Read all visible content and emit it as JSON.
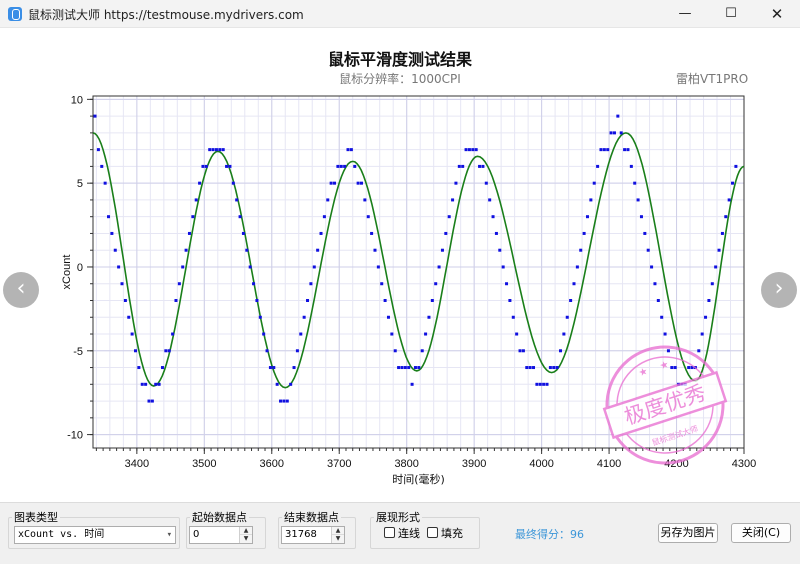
{
  "window": {
    "title": "鼠标测试大师 https://testmouse.mydrivers.com",
    "minimize_glyph": "—",
    "maximize_glyph": "☐",
    "close_glyph": "✕"
  },
  "nav": {
    "prev_glyph": "‹",
    "next_glyph": "›"
  },
  "header": {
    "title": "鼠标平滑度测试结果",
    "subtitle": "鼠标分辨率：1000CPI",
    "device": "雷柏VT1PRO"
  },
  "stamp": {
    "text": "极度优秀",
    "inner_text": "鼠标测试大师",
    "color": "#e86ad0"
  },
  "chart_data": {
    "type": "scatter",
    "xlabel": "时间(毫秒)",
    "ylabel": "xCount",
    "xlim": [
      3335,
      3303.5
    ],
    "x_range": [
      3335,
      3300
    ],
    "ylim": [
      -10.8,
      10.2
    ],
    "x_ticks": [
      3400,
      3500,
      3600,
      3700,
      3800,
      3900,
      4000,
      4100,
      4200,
      4300
    ],
    "y_ticks": [
      10,
      5,
      0,
      -5,
      -10
    ],
    "grid": true,
    "series": [
      {
        "kind": "points",
        "color": "#1010e0",
        "points": [
          [
            3338,
            9
          ],
          [
            3343,
            7
          ],
          [
            3348,
            6
          ],
          [
            3353,
            5
          ],
          [
            3358,
            3
          ],
          [
            3363,
            2
          ],
          [
            3368,
            1
          ],
          [
            3373,
            0
          ],
          [
            3378,
            -1
          ],
          [
            3383,
            -2
          ],
          [
            3388,
            -3
          ],
          [
            3393,
            -4
          ],
          [
            3398,
            -5
          ],
          [
            3403,
            -6
          ],
          [
            3408,
            -7
          ],
          [
            3413,
            -7
          ],
          [
            3418,
            -8
          ],
          [
            3423,
            -8
          ],
          [
            3428,
            -7
          ],
          [
            3433,
            -7
          ],
          [
            3438,
            -6
          ],
          [
            3443,
            -5
          ],
          [
            3448,
            -5
          ],
          [
            3453,
            -4
          ],
          [
            3458,
            -2
          ],
          [
            3463,
            -1
          ],
          [
            3468,
            0
          ],
          [
            3473,
            1
          ],
          [
            3478,
            2
          ],
          [
            3483,
            3
          ],
          [
            3488,
            4
          ],
          [
            3493,
            5
          ],
          [
            3498,
            6
          ],
          [
            3503,
            6
          ],
          [
            3508,
            7
          ],
          [
            3513,
            7
          ],
          [
            3518,
            7
          ],
          [
            3523,
            7
          ],
          [
            3528,
            7
          ],
          [
            3533,
            6
          ],
          [
            3538,
            6
          ],
          [
            3543,
            5
          ],
          [
            3548,
            4
          ],
          [
            3553,
            3
          ],
          [
            3558,
            2
          ],
          [
            3563,
            1
          ],
          [
            3568,
            0
          ],
          [
            3573,
            -1
          ],
          [
            3578,
            -2
          ],
          [
            3583,
            -3
          ],
          [
            3588,
            -4
          ],
          [
            3593,
            -5
          ],
          [
            3598,
            -6
          ],
          [
            3603,
            -6
          ],
          [
            3608,
            -7
          ],
          [
            3613,
            -8
          ],
          [
            3618,
            -8
          ],
          [
            3623,
            -8
          ],
          [
            3628,
            -7
          ],
          [
            3633,
            -6
          ],
          [
            3638,
            -5
          ],
          [
            3643,
            -4
          ],
          [
            3648,
            -3
          ],
          [
            3653,
            -2
          ],
          [
            3658,
            -1
          ],
          [
            3663,
            0
          ],
          [
            3668,
            1
          ],
          [
            3673,
            2
          ],
          [
            3678,
            3
          ],
          [
            3683,
            4
          ],
          [
            3688,
            5
          ],
          [
            3693,
            5
          ],
          [
            3698,
            6
          ],
          [
            3703,
            6
          ],
          [
            3708,
            6
          ],
          [
            3713,
            7
          ],
          [
            3718,
            7
          ],
          [
            3723,
            6
          ],
          [
            3728,
            5
          ],
          [
            3733,
            5
          ],
          [
            3738,
            4
          ],
          [
            3743,
            3
          ],
          [
            3748,
            2
          ],
          [
            3753,
            1
          ],
          [
            3758,
            0
          ],
          [
            3763,
            -1
          ],
          [
            3768,
            -2
          ],
          [
            3773,
            -3
          ],
          [
            3778,
            -4
          ],
          [
            3783,
            -5
          ],
          [
            3788,
            -6
          ],
          [
            3793,
            -6
          ],
          [
            3798,
            -6
          ],
          [
            3803,
            -6
          ],
          [
            3808,
            -7
          ],
          [
            3813,
            -6
          ],
          [
            3818,
            -6
          ],
          [
            3823,
            -5
          ],
          [
            3828,
            -4
          ],
          [
            3833,
            -3
          ],
          [
            3838,
            -2
          ],
          [
            3843,
            -1
          ],
          [
            3848,
            0
          ],
          [
            3853,
            1
          ],
          [
            3858,
            2
          ],
          [
            3863,
            3
          ],
          [
            3868,
            4
          ],
          [
            3873,
            5
          ],
          [
            3878,
            6
          ],
          [
            3883,
            6
          ],
          [
            3888,
            7
          ],
          [
            3893,
            7
          ],
          [
            3898,
            7
          ],
          [
            3903,
            7
          ],
          [
            3908,
            6
          ],
          [
            3913,
            6
          ],
          [
            3918,
            5
          ],
          [
            3923,
            4
          ],
          [
            3928,
            3
          ],
          [
            3933,
            2
          ],
          [
            3938,
            1
          ],
          [
            3943,
            0
          ],
          [
            3948,
            -1
          ],
          [
            3953,
            -2
          ],
          [
            3958,
            -3
          ],
          [
            3963,
            -4
          ],
          [
            3968,
            -5
          ],
          [
            3973,
            -5
          ],
          [
            3978,
            -6
          ],
          [
            3983,
            -6
          ],
          [
            3988,
            -6
          ],
          [
            3993,
            -7
          ],
          [
            3998,
            -7
          ],
          [
            4003,
            -7
          ],
          [
            4008,
            -7
          ],
          [
            4013,
            -6
          ],
          [
            4018,
            -6
          ],
          [
            4023,
            -6
          ],
          [
            4028,
            -5
          ],
          [
            4033,
            -4
          ],
          [
            4038,
            -3
          ],
          [
            4043,
            -2
          ],
          [
            4048,
            -1
          ],
          [
            4053,
            0
          ],
          [
            4058,
            1
          ],
          [
            4063,
            2
          ],
          [
            4068,
            3
          ],
          [
            4073,
            4
          ],
          [
            4078,
            5
          ],
          [
            4083,
            6
          ],
          [
            4088,
            7
          ],
          [
            4093,
            7
          ],
          [
            4098,
            7
          ],
          [
            4103,
            8
          ],
          [
            4108,
            8
          ],
          [
            4113,
            9
          ],
          [
            4118,
            8
          ],
          [
            4123,
            7
          ],
          [
            4128,
            7
          ],
          [
            4133,
            6
          ],
          [
            4138,
            5
          ],
          [
            4143,
            4
          ],
          [
            4148,
            3
          ],
          [
            4153,
            2
          ],
          [
            4158,
            1
          ],
          [
            4163,
            0
          ],
          [
            4168,
            -1
          ],
          [
            4173,
            -2
          ],
          [
            4178,
            -3
          ],
          [
            4183,
            -4
          ],
          [
            4188,
            -5
          ],
          [
            4193,
            -6
          ],
          [
            4198,
            -6
          ],
          [
            4203,
            -7
          ],
          [
            4208,
            -7
          ],
          [
            4213,
            -7
          ],
          [
            4218,
            -6
          ],
          [
            4223,
            -6
          ],
          [
            4228,
            -6
          ],
          [
            4233,
            -5
          ],
          [
            4238,
            -4
          ],
          [
            4243,
            -3
          ],
          [
            4248,
            -2
          ],
          [
            4253,
            -1
          ],
          [
            4258,
            0
          ],
          [
            4263,
            1
          ],
          [
            4268,
            2
          ],
          [
            4273,
            3
          ],
          [
            4278,
            4
          ],
          [
            4283,
            5
          ],
          [
            4288,
            6
          ]
        ]
      },
      {
        "kind": "smooth-line",
        "color": "#1a7f1a",
        "knots": [
          [
            3335,
            8
          ],
          [
            3425,
            -7.1
          ],
          [
            3520,
            6.9
          ],
          [
            3620,
            -7.2
          ],
          [
            3720,
            6.3
          ],
          [
            3815,
            -6.2
          ],
          [
            3905,
            6.6
          ],
          [
            4015,
            -6.3
          ],
          [
            4125,
            8
          ],
          [
            4228,
            -6.8
          ],
          [
            4300,
            6
          ]
        ]
      }
    ]
  },
  "controls": {
    "chart_type": {
      "legend": "图表类型",
      "value": "xCount vs. 时间",
      "arrow": "▾"
    },
    "start_point": {
      "legend": "起始数据点",
      "value": "0"
    },
    "end_point": {
      "legend": "结束数据点",
      "value": "31768"
    },
    "display": {
      "legend": "展现形式",
      "line_label": "连线",
      "fill_label": "填充",
      "line_checked": false,
      "fill_checked": false
    },
    "spin_up": "▲",
    "spin_down": "▼",
    "score": "最终得分：96",
    "save_button": "另存为图片",
    "close_button": "关闭(C)"
  }
}
